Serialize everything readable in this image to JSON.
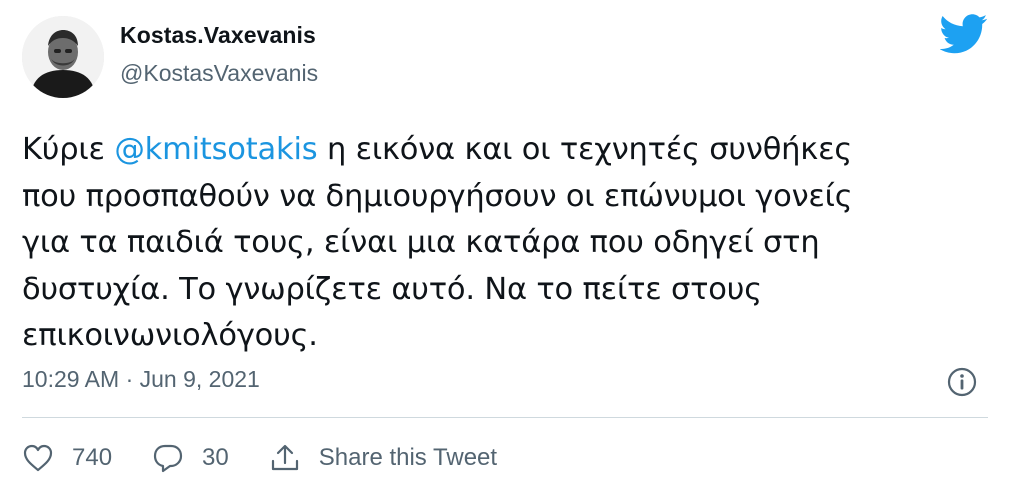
{
  "author": {
    "name": "Kostas.Vaxevanis",
    "handle": "@KostasVaxevanis"
  },
  "tweet": {
    "lines": [
      {
        "before": "Κύριε ",
        "mention": "@kmitsotakis",
        "after": " η εικόνα και οι τεχνητές συνθήκες"
      },
      {
        "text": "που προσπαθούν να δημιουργήσουν οι επώνυμοι γονείς"
      },
      {
        "text": "για τα παιδιά τους, είναι μια κατάρα που οδηγεί στη"
      },
      {
        "text": "δυστυχία. Το γνωρίζετε αυτό. Να το πείτε στους"
      },
      {
        "text": "επικοινωνιολόγους."
      }
    ],
    "timestamp": "10:29 AM · Jun 9, 2021"
  },
  "actions": {
    "likes": "740",
    "replies": "30",
    "share_label": "Share this Tweet"
  },
  "icons": {
    "brand": "twitter-bird-icon",
    "info": "info-icon",
    "like": "heart-icon",
    "reply": "comment-icon",
    "share": "share-icon"
  },
  "colors": {
    "brand": "#1da1f2",
    "mention": "#1b95e0",
    "secondary_text": "#536471"
  }
}
